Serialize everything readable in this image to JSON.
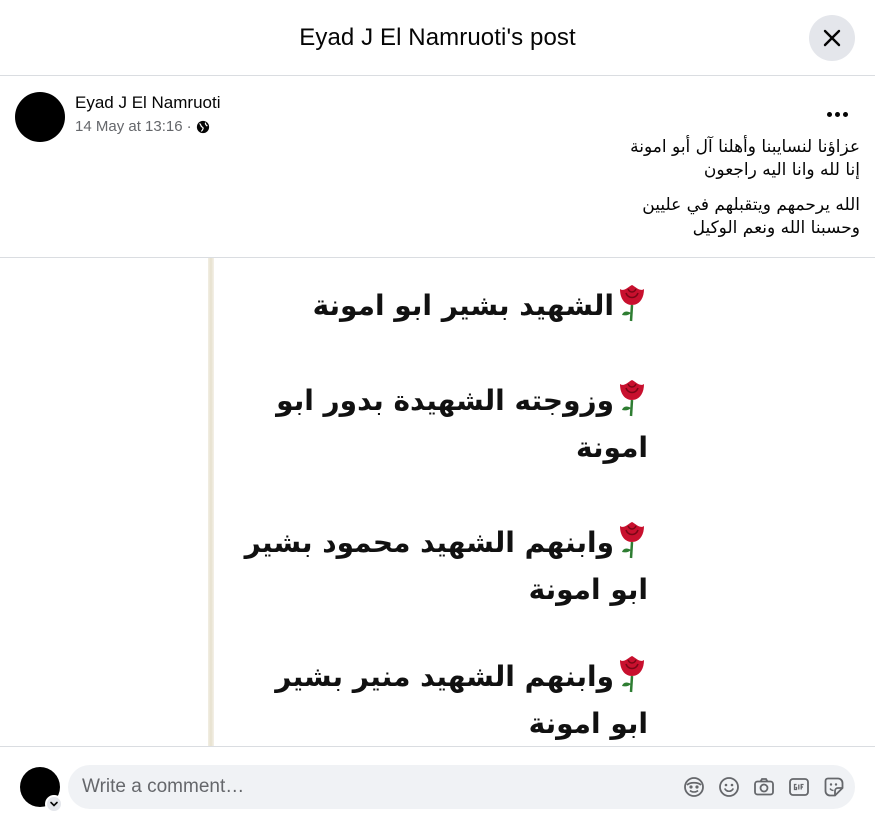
{
  "header": {
    "title": "Eyad J El Namruoti's post"
  },
  "post": {
    "author": "Eyad J El Namruoti",
    "timestamp": "14 May at 13:16",
    "separator": "·",
    "privacy_icon": "globe-icon",
    "text_lines": [
      "عزاؤنا لنسايبنا وأهلنا آل أبو امونة",
      "إنا لله وانا اليه راجعون",
      "الله يرحمهم ويتقبلهم في عليين",
      "وحسبنا الله ونعم الوكيل"
    ]
  },
  "image": {
    "lines": [
      "الشهيد بشير ابو امونة",
      "وزوجته الشهيدة بدور ابو امونة",
      "وابنهم الشهيد محمود بشير ابو امونة",
      "وابنهم الشهيد منير بشير ابو امونة"
    ]
  },
  "comment": {
    "placeholder": "Write a comment…",
    "icons": [
      "avatar-sticker-icon",
      "emoji-icon",
      "camera-icon",
      "gif-icon",
      "sticker-icon"
    ]
  },
  "colors": {
    "divider": "#dadde1",
    "secondary_text": "#65676b",
    "button_bg": "#e4e6eb",
    "input_bg": "#f0f2f5",
    "rose": "#c8102e"
  }
}
